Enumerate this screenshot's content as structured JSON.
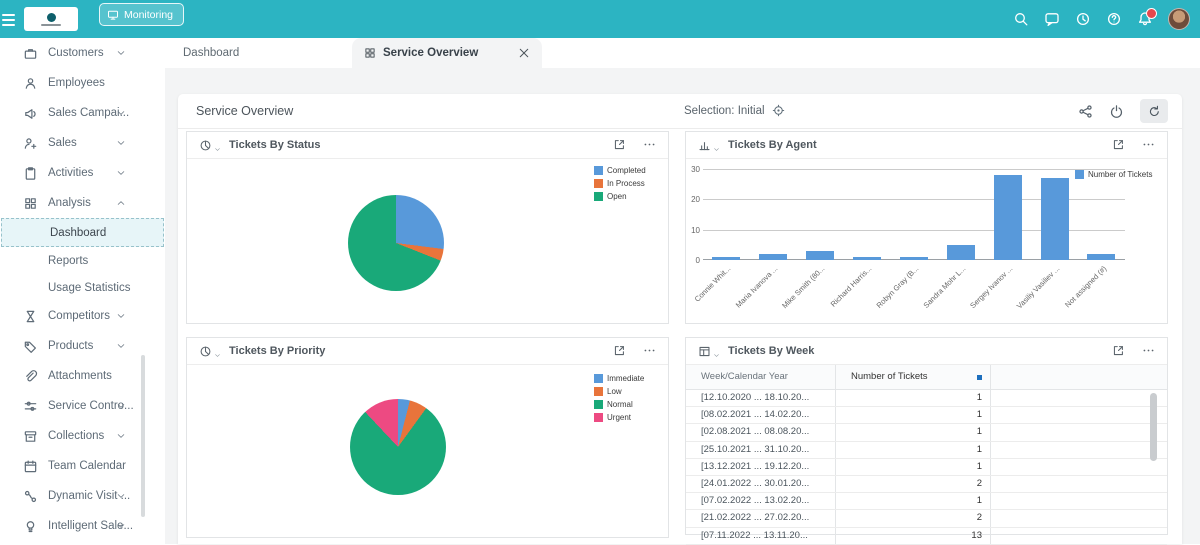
{
  "colors": {
    "topbar": "#2cb4c2",
    "chart_blue": "#5899da",
    "chart_orange": "#e8743b",
    "chart_green": "#19a979",
    "chart_pink": "#ed4a82"
  },
  "topbar": {
    "monitoring_label": "Monitoring"
  },
  "tabs": [
    {
      "label": "Dashboard",
      "active": false
    },
    {
      "label": "Service Overview",
      "active": true,
      "closable": true
    }
  ],
  "sidebar": {
    "items": [
      {
        "label": "Customers",
        "icon": "briefcase-icon",
        "expandable": true
      },
      {
        "label": "Employees",
        "icon": "person-icon"
      },
      {
        "label": "Sales Campai...",
        "icon": "megaphone-icon",
        "expandable": true
      },
      {
        "label": "Sales",
        "icon": "sales-person-icon",
        "expandable": true
      },
      {
        "label": "Activities",
        "icon": "clipboard-icon",
        "expandable": true
      },
      {
        "label": "Analysis",
        "icon": "grid-icon",
        "expandable": true,
        "expanded": true
      },
      {
        "label": "Dashboard",
        "sub_item": true,
        "selected": true
      },
      {
        "label": "Reports",
        "sub_item": true
      },
      {
        "label": "Usage Statistics",
        "sub_item": true
      },
      {
        "label": "Competitors",
        "icon": "hourglass-icon",
        "expandable": true
      },
      {
        "label": "Products",
        "icon": "tag-icon",
        "expandable": true
      },
      {
        "label": "Attachments",
        "icon": "paperclip-icon"
      },
      {
        "label": "Service Contro...",
        "icon": "sliders-icon",
        "expandable": true
      },
      {
        "label": "Collections",
        "icon": "archive-icon",
        "expandable": true
      },
      {
        "label": "Team Calendar",
        "icon": "calendar-icon"
      },
      {
        "label": "Dynamic Visit ...",
        "icon": "route-icon",
        "expandable": true
      },
      {
        "label": "Intelligent Sale...",
        "icon": "bulb-icon",
        "expandable": true
      }
    ]
  },
  "main": {
    "title": "Service Overview",
    "selection_label": "Selection: Initial"
  },
  "chart_data": [
    {
      "type": "pie",
      "title": "Tickets By Status",
      "unit": "percent",
      "legend_position": "right",
      "slices": [
        {
          "label": "Completed",
          "value": 27,
          "color": "#5899da"
        },
        {
          "label": "In Process",
          "value": 4,
          "color": "#e8743b"
        },
        {
          "label": "Open",
          "value": 69,
          "color": "#19a979"
        }
      ]
    },
    {
      "type": "bar",
      "title": "Tickets By Agent",
      "xlabel": "",
      "ylabel": "",
      "ylim": [
        0,
        30
      ],
      "yticks": [
        0,
        10,
        20,
        30
      ],
      "grid": true,
      "legend_position": "top-right",
      "categories": [
        "Connie Whit...",
        "Maria Ivanova ...",
        "Mike Smith (80...",
        "Richard Harris...",
        "Robyn Gray (B...",
        "Sandra Mohr L...",
        "Sergey Ivanov ...",
        "Vasiliy Vasiliev ...",
        "Not assigned (#)"
      ],
      "series": [
        {
          "name": "Number of Tickets",
          "color": "#5899da",
          "values": [
            1,
            2,
            3,
            1,
            1,
            5,
            28,
            27,
            2
          ]
        }
      ]
    },
    {
      "type": "pie",
      "title": "Tickets By Priority",
      "unit": "percent",
      "legend_position": "right",
      "slices": [
        {
          "label": "Immediate",
          "value": 4,
          "color": "#5899da"
        },
        {
          "label": "Low",
          "value": 6,
          "color": "#e8743b"
        },
        {
          "label": "Normal",
          "value": 78,
          "color": "#19a979"
        },
        {
          "label": "Urgent",
          "value": 12,
          "color": "#ed4a82"
        }
      ]
    },
    {
      "type": "table",
      "title": "Tickets By Week",
      "columns": [
        "Week/Calendar Year",
        "Number of Tickets"
      ],
      "rows": [
        [
          "[12.10.2020 ... 18.10.20...",
          1
        ],
        [
          "[08.02.2021 ... 14.02.20...",
          1
        ],
        [
          "[02.08.2021 ... 08.08.20...",
          1
        ],
        [
          "[25.10.2021 ... 31.10.20...",
          1
        ],
        [
          "[13.12.2021 ... 19.12.20...",
          1
        ],
        [
          "[24.01.2022 ... 30.01.20...",
          2
        ],
        [
          "[07.02.2022 ... 13.02.20...",
          1
        ],
        [
          "[21.02.2022 ... 27.02.20...",
          2
        ],
        [
          "[07.11.2022 ... 13.11.20...",
          13
        ]
      ]
    }
  ]
}
